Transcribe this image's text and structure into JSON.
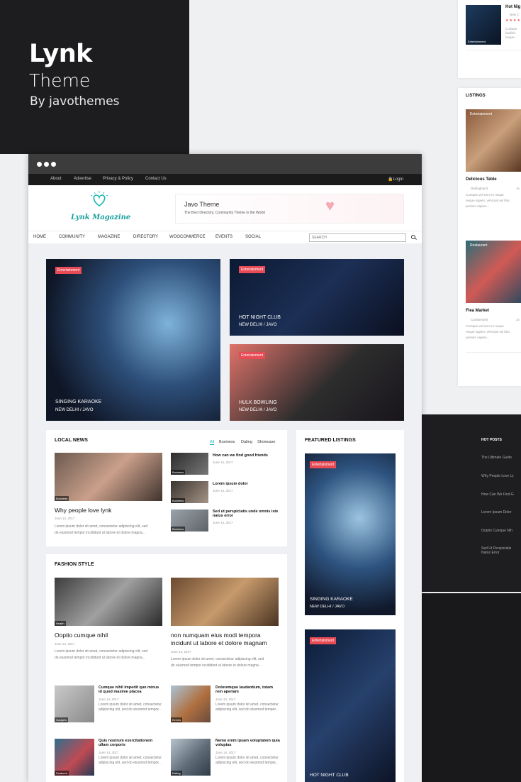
{
  "promo": {
    "brand": "Lynk",
    "theme": "Theme",
    "byline": "By javothemes"
  },
  "colors": {
    "accent": "#e84b56",
    "dark": "#1d1d1f"
  },
  "right_top_card": {
    "title": "Hot Nig",
    "line1": "New C",
    "line2": "Cuisque",
    "line3": "facilisis",
    "line4": "neque -",
    "tag": "Entertainment"
  },
  "listings": {
    "heading": "LISTINGS",
    "items": [
      {
        "tag": "Entertainment",
        "title": "Delicious Table",
        "loc": "Darlinghurst",
        "extra": "Ja",
        "desc1": "Cumque vel sem eo neque",
        "desc2": "neque sapien, vehicula vel bloc",
        "desc3": "pretium sapien..."
      },
      {
        "tag": "Restaurant",
        "title": "Flea Market",
        "loc": "Camberwell",
        "extra": "Ja",
        "desc1": "Cumque vel sem eo neque",
        "desc2": "neque sapien, vehicula vel bloc",
        "desc3": "pretium sapien..."
      }
    ]
  },
  "hot_posts": {
    "heading": "HOT POSTS",
    "items": [
      "The Ultimate Guide",
      "Why People Love Ly",
      "How Can We Find G",
      "Lorem Ipsum Dolor",
      "Ooptio Cumque Nih",
      "Sed Ut Perspiciatis",
      "Natus Error"
    ]
  },
  "topbar": {
    "links": [
      "About",
      "Advertise",
      "Privacy & Policy",
      "Contact Us"
    ],
    "login": "Login"
  },
  "logo": {
    "name": "Lynk Magazine"
  },
  "banner": {
    "title": "Javo Theme",
    "subtitle": "The Best Directory, Community Theme in the World"
  },
  "nav": {
    "items": [
      "HOME",
      "COMMUNITY",
      "MAGAZINE",
      "DIRECTORY",
      "WOOCOMMERCE",
      "EVENTS",
      "SOCIAL"
    ],
    "search_placeholder": "SEARCH"
  },
  "hero": {
    "big": {
      "tag": "Entertainment",
      "title": "SINGING KARAOKE",
      "sub": "NEW DELHI / JAVO"
    },
    "top": {
      "tag": "Entertainment",
      "title": "HOT NIGHT CLUB",
      "sub": "NEW DELHI / JAVO"
    },
    "bottom": {
      "tag": "Entertainment",
      "title": "HULK BOWLING",
      "sub": "NEW DELHI / JAVO"
    }
  },
  "local_news": {
    "heading": "LOCAL NEWS",
    "tabs": [
      "All",
      "Business",
      "Dating",
      "Showcase"
    ],
    "main": {
      "tag": "Business",
      "title": "Why people love lynk",
      "date": "June 14, 2017",
      "text1": "Lorem ipsum dolor sit amet, consectetur adipiscing elit, sed",
      "text2": "do eiusmod tempor incididunt ut labore et dolore magna..."
    },
    "list": [
      {
        "tag": "Business",
        "title": "How can we find good friends",
        "date": "June 14, 2017"
      },
      {
        "tag": "Business",
        "title": "Lorem ipsum dolor",
        "date": "June 14, 2017"
      },
      {
        "tag": "Business",
        "title": "Sed ut perspiciatis unde omnis iste natus error",
        "date": "June 14, 2017"
      }
    ]
  },
  "featured": {
    "heading": "FEATURED LISTINGS",
    "items": [
      {
        "tag": "Entertainment",
        "title": "SINGING KARAOKE",
        "sub": "NEW DELHI / JAVO"
      },
      {
        "tag": "Entertainment",
        "title": "HOT NIGHT CLUB",
        "sub": ""
      }
    ]
  },
  "fashion": {
    "heading": "FASHION STYLE",
    "main": [
      {
        "tag": "Health",
        "title": "Ooptio cumque nihil",
        "date": "June 14, 2017",
        "text1": "Lorem ipsum dolor sit amet, consectetur adipiscing elit, sed",
        "text2": "do eiusmod tempor incididunt ut labore et dolore magna..."
      },
      {
        "tag": "",
        "title": "non numquam eius modi tempora incidunt ut labore et dolore magnam",
        "date": "June 14, 2017",
        "text1": "Lorem ipsum dolor sit amet, consectetur adipiscing elit, sed",
        "text2": "do eiusmod tempor incididunt ut labore et dolore magna..."
      }
    ],
    "list": [
      {
        "tag": "Gadgets",
        "title": "Cumque nihil impedit quo minus id quod maxime placea",
        "date": "June 14, 2017",
        "text": "Lorem ipsum dolor sit amet, consectetur adipiscing elit, sed do eiusmod tempor..."
      },
      {
        "tag": "Events",
        "title": "Doloremque laudantium, totam rem aperiam",
        "date": "June 14, 2017",
        "text": "Lorem ipsum dolor sit amet, consectetur adipiscing elit, sed do eiusmod tempor..."
      },
      {
        "tag": "Featured",
        "title": "Quis nostrum exercitationem ullam corporis",
        "date": "June 14, 2017",
        "text": "Lorem ipsum dolor sit amet, consectetur adipiscing elit, sed do eiusmod tempor..."
      },
      {
        "tag": "Dating",
        "title": "Nemo enim ipsam voluptatem quia voluptas",
        "date": "June 14, 2017",
        "text": "Lorem ipsum dolor sit amet, consectetur adipiscing elit, sed do eiusmod tempor..."
      }
    ]
  }
}
